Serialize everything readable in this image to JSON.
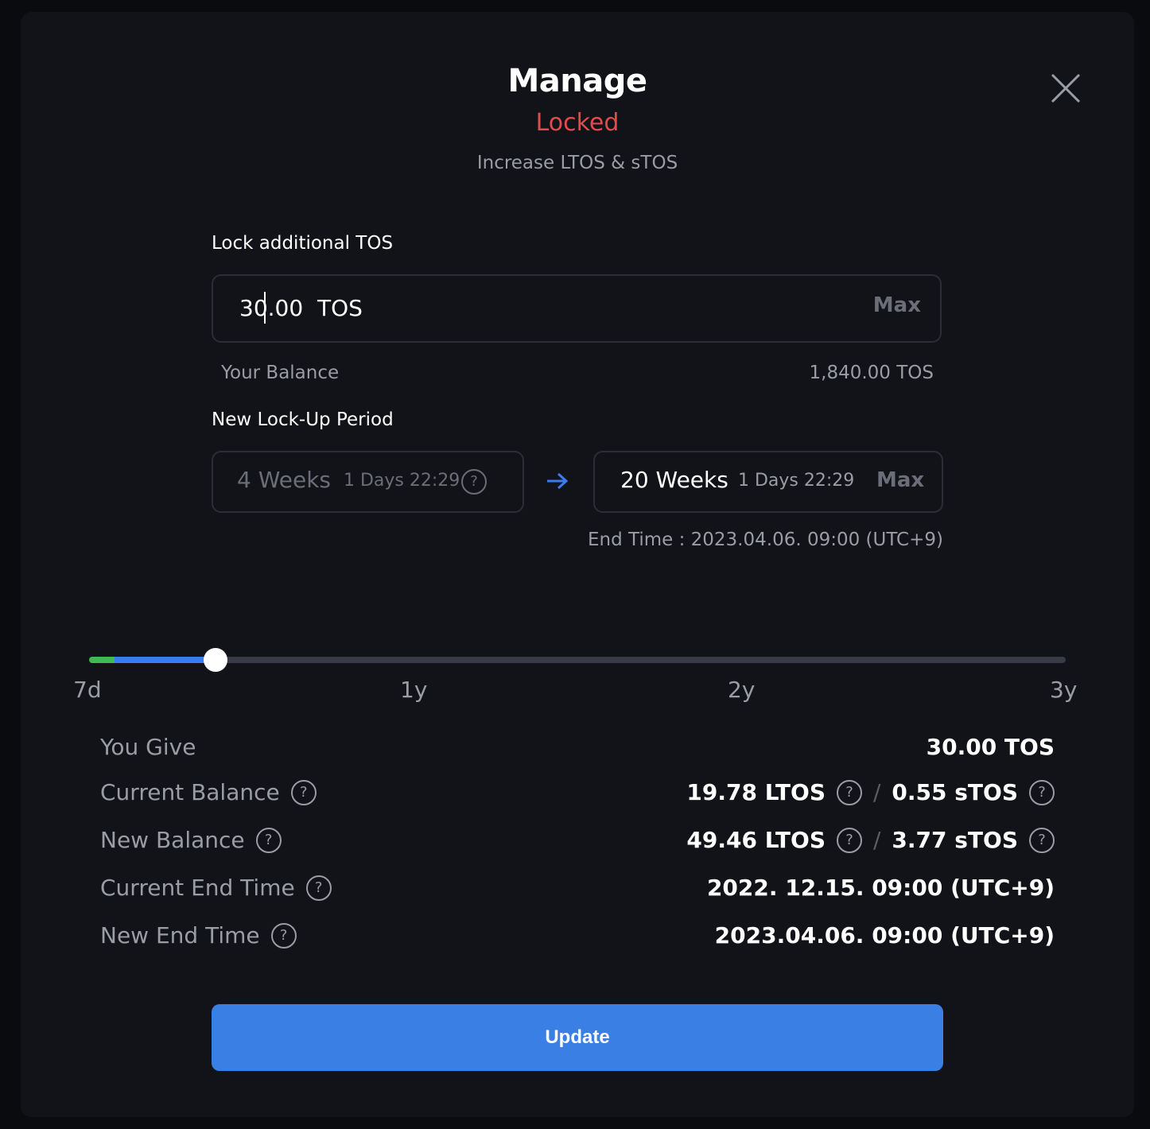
{
  "modal": {
    "title": "Manage",
    "status": "Locked",
    "status_color": "#e5484d",
    "subtitle": "Increase LTOS & sTOS"
  },
  "lock_amount": {
    "label": "Lock additional TOS",
    "value": "30.00",
    "unit": "TOS",
    "max_label": "Max",
    "balance_label": "Your Balance",
    "balance_value": "1,840.00 TOS"
  },
  "lock_period": {
    "label": "New Lock-Up Period",
    "current_weeks": "4 Weeks",
    "current_days": "1 Days 22:29",
    "new_weeks": "20 Weeks",
    "new_days": "1 Days 22:29",
    "max_label": "Max",
    "end_time_text": "End Time : 2023.04.06. 09:00 (UTC+9)"
  },
  "slider": {
    "ticks": [
      "7d",
      "1y",
      "2y",
      "3y"
    ],
    "current_weeks": 4,
    "selected_weeks": 20,
    "min_label": "7d",
    "max_label": "3y",
    "colors": {
      "current": "#3fb950",
      "added": "#3a7bf0",
      "track": "#383b45"
    }
  },
  "summary": {
    "you_give_label": "You Give",
    "you_give_value": "30.00 TOS",
    "current_balance_label": "Current Balance",
    "current_ltos": "19.78 LTOS",
    "current_stos": "0.55 sTOS",
    "new_balance_label": "New Balance",
    "new_ltos": "49.46 LTOS",
    "new_stos": "3.77 sTOS",
    "current_end_label": "Current End Time",
    "current_end_value": "2022. 12.15. 09:00 (UTC+9)",
    "new_end_label": "New End Time",
    "new_end_value": "2023.04.06. 09:00 (UTC+9)",
    "separator": "/",
    "help_glyph": "?"
  },
  "actions": {
    "update_label": "Update",
    "accent": "#3a7fe3"
  },
  "icons": {
    "close": "close-icon",
    "arrow": "arrow-right-icon",
    "help": "help-circle-icon"
  }
}
